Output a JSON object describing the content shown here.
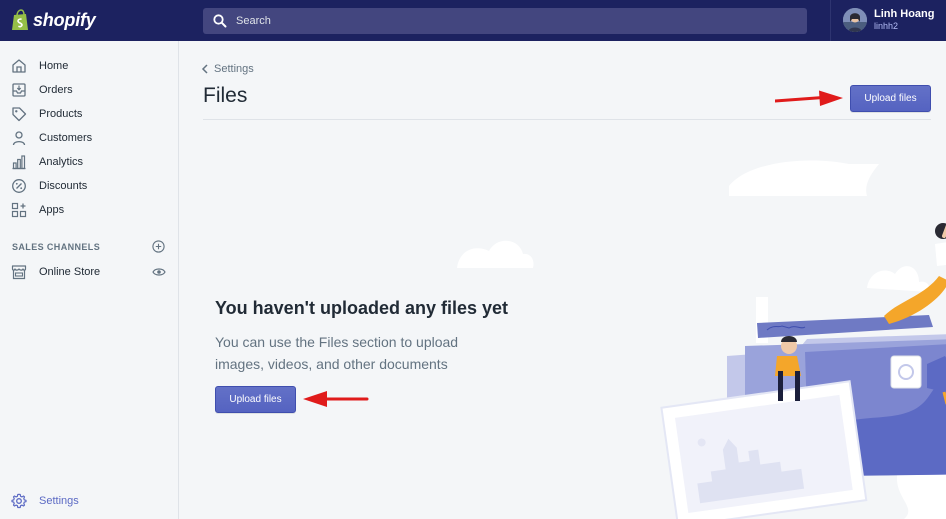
{
  "brand": {
    "name": "shopify",
    "color": "#95bf47"
  },
  "search": {
    "placeholder": "Search"
  },
  "user": {
    "name": "Linh Hoang",
    "handle": "linhh2"
  },
  "sidebar": {
    "items": [
      {
        "label": "Home",
        "icon": "home-icon"
      },
      {
        "label": "Orders",
        "icon": "orders-icon"
      },
      {
        "label": "Products",
        "icon": "tag-icon"
      },
      {
        "label": "Customers",
        "icon": "person-icon"
      },
      {
        "label": "Analytics",
        "icon": "bar-chart-icon"
      },
      {
        "label": "Discounts",
        "icon": "discount-icon"
      },
      {
        "label": "Apps",
        "icon": "apps-icon"
      }
    ],
    "sales_channels": {
      "title": "SALES CHANNELS",
      "items": [
        {
          "label": "Online Store",
          "icon": "store-icon"
        }
      ]
    },
    "settings": {
      "label": "Settings",
      "icon": "gear-icon"
    }
  },
  "main": {
    "breadcrumb": "Settings",
    "title": "Files",
    "upload_button": "Upload files",
    "empty_state": {
      "heading": "You haven't uploaded any files yet",
      "description": "You can use the Files section to upload images, videos, and other documents",
      "button": "Upload files"
    }
  },
  "colors": {
    "topbar": "#1c2260",
    "primary": "#5c6ac4",
    "annotation_arrow": "#e01b1b"
  }
}
